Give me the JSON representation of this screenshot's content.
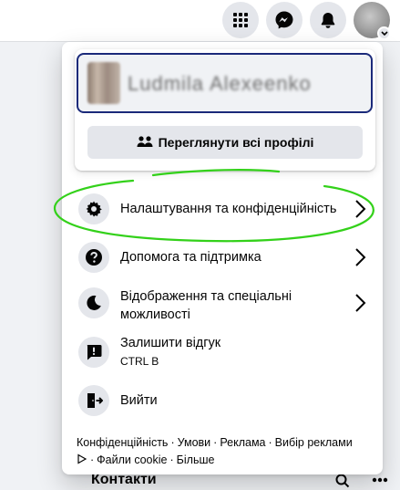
{
  "topbar": {
    "icons": [
      "grid-icon",
      "messenger-icon",
      "bell-icon"
    ]
  },
  "profile": {
    "name": "Ludmila Alexeenko",
    "see_all_label": "Переглянути всі профілі"
  },
  "menu": {
    "items": [
      {
        "label": "Налаштування та конфіденційність",
        "icon": "gear-icon",
        "has_chevron": true
      },
      {
        "label": "Допомога та підтримка",
        "icon": "question-icon",
        "has_chevron": true
      },
      {
        "label": "Відображення та спеціальні",
        "label2": "можливості",
        "icon": "moon-icon",
        "has_chevron": true
      },
      {
        "label": "Залишити відгук",
        "sub": "CTRL B",
        "icon": "feedback-icon",
        "has_chevron": false
      },
      {
        "label": "Вийти",
        "icon": "logout-icon",
        "has_chevron": false
      }
    ]
  },
  "footer": {
    "links": [
      "Конфіденційність",
      "Умови",
      "Реклама",
      "Вибір реклами",
      "Файли cookie",
      "Більше"
    ],
    "separator": "·"
  },
  "page": {
    "contacts_label": "Контакти"
  },
  "colors": {
    "accent_border": "#1b2a7a",
    "annotation": "#33d11a",
    "icon_bg": "#e4e6eb"
  }
}
